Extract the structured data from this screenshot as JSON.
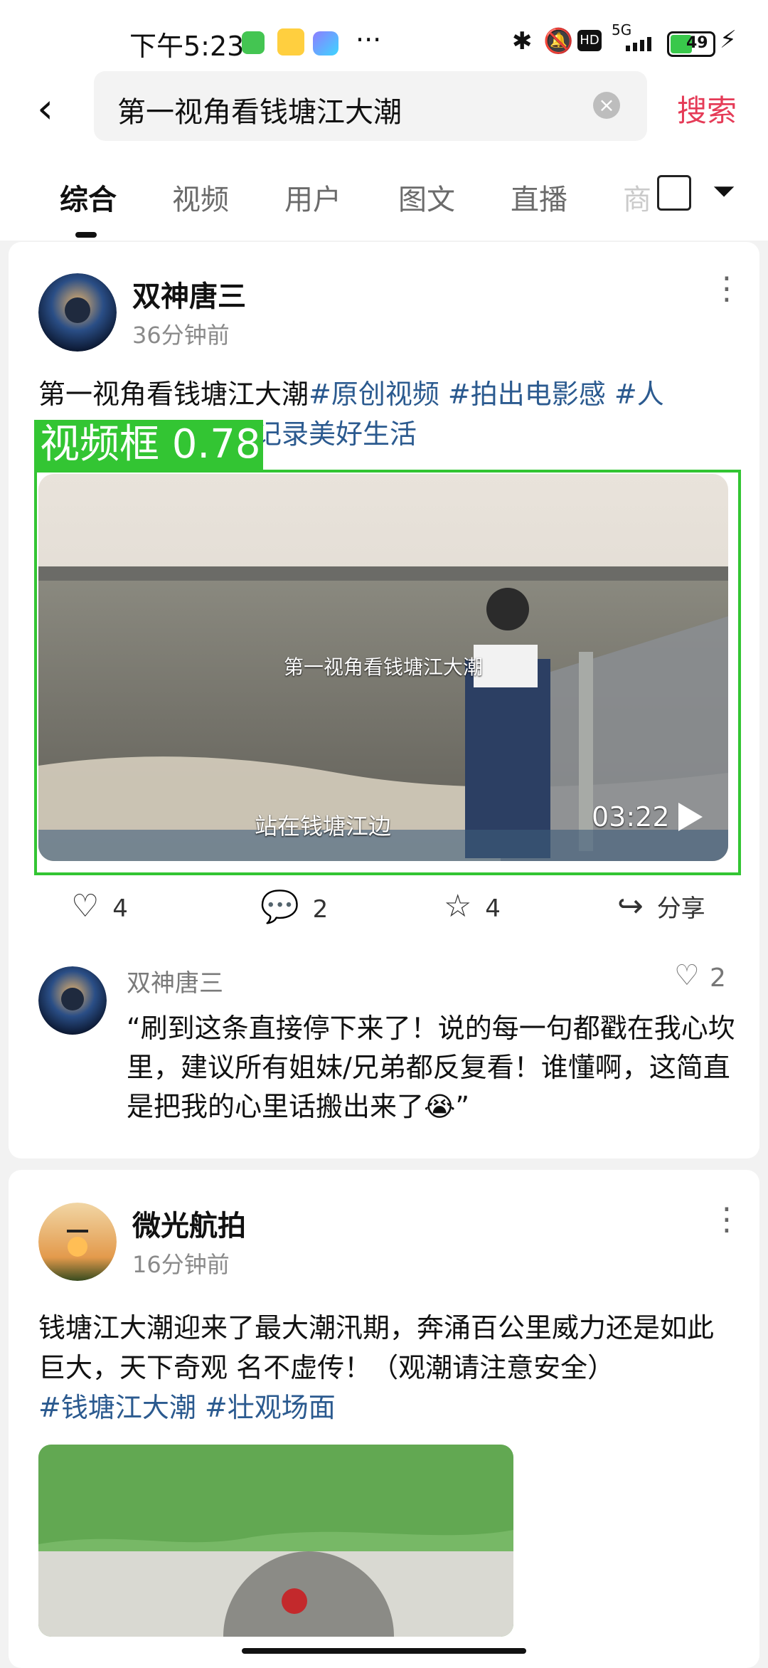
{
  "status": {
    "time": "下午5:23",
    "icons": [
      "green-app-icon",
      "58-app-icon",
      "cloud-app-icon",
      "more-dots-icon",
      "bluetooth-icon",
      "mute-icon",
      "hd-icon",
      "5g-signal-icon",
      "battery-icon",
      "charging-icon"
    ],
    "battery": "49",
    "network": "5G"
  },
  "header": {
    "query": "第一视角看钱塘江大潮",
    "search_label": "搜索",
    "tabs": [
      "综合",
      "视频",
      "用户",
      "图文",
      "直播",
      "商"
    ]
  },
  "post1": {
    "author": "双神唐三",
    "time": "36分钟前",
    "text_main": "第一视角看钱塘江大潮",
    "tags_line1": "#原创视频 #拍出电影感 #人",
    "tags_line2": "记录美好生活",
    "video_title": "第一视角看钱塘江大潮",
    "video_caption": "站在钱塘江边",
    "duration": "03:22",
    "overlay_label": "视频框 0.78",
    "likes": "4",
    "comments": "2",
    "favorites": "4",
    "share_label": "分享",
    "top_comment": {
      "author": "双神唐三",
      "likes": "2",
      "text": "“刷到这条直接停下来了！说的每一句都戳在我心坎里，建议所有姐妹/兄弟都反复看！谁懂啊，这简直是把我的心里话搬出来了😭”"
    }
  },
  "post2": {
    "author": "微光航拍",
    "time": "16分钟前",
    "text": "钱塘江大潮迎来了最大潮汛期，奔涌百公里威力还是如此巨大，天下奇观 名不虚传！（观潮请注意安全）",
    "tags": "#钱塘江大潮 #壮观场面"
  }
}
